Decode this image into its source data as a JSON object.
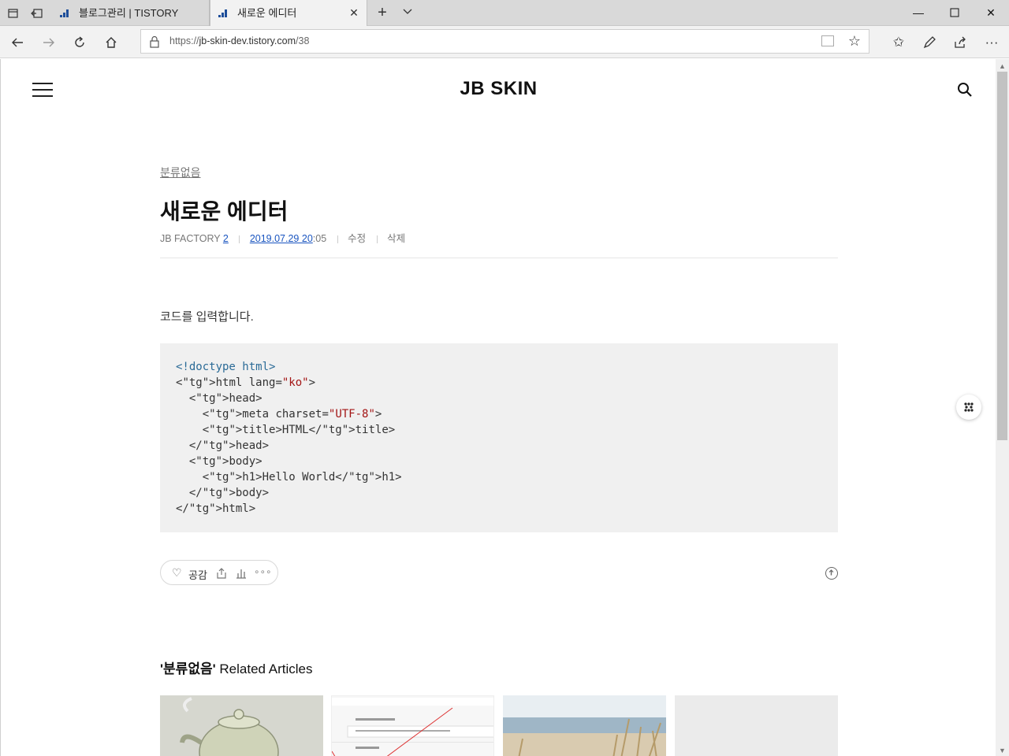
{
  "browser": {
    "tabs": [
      {
        "title": "블로그관리 | TISTORY",
        "active": false
      },
      {
        "title": "새로운 에디터",
        "active": true
      }
    ],
    "address": {
      "scheme": "https://",
      "host": "jb-skin-dev.tistory.com",
      "path": "/38"
    }
  },
  "site": {
    "title": "JB SKIN"
  },
  "post": {
    "category": "분류없음",
    "title": "새로운 에디터",
    "author": "JB FACTORY",
    "comments": "2",
    "date_link": "2019.07.29 20",
    "date_rest": ":05",
    "edit_label": "수정",
    "delete_label": "삭제",
    "body": "코드를 입력합니다."
  },
  "code_block": {
    "lines": [
      "<!doctype html>",
      "<html lang=\"ko\">",
      "  <head>",
      "    <meta charset=\"UTF-8\">",
      "    <title>HTML</title>",
      "  </head>",
      "  <body>",
      "    <h1>Hello World</h1>",
      "  </body>",
      "</html>"
    ]
  },
  "share": {
    "like_label": "공감"
  },
  "related": {
    "category": "'분류없음'",
    "label": " Related Articles"
  },
  "colors": {
    "link": "#1a55c0",
    "code_bg": "#f0f0f0",
    "favicon": "#1e4e9a"
  }
}
